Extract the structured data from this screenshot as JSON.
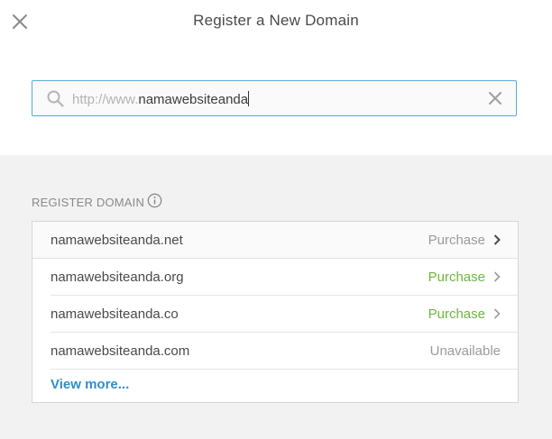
{
  "header": {
    "title": "Register a New Domain"
  },
  "search": {
    "prefix": "http://www.",
    "value": "namawebsiteanda"
  },
  "section": {
    "label": "REGISTER DOMAIN"
  },
  "domains": [
    {
      "name": "namawebsiteanda.net",
      "action": "Purchase",
      "status": "available-hover"
    },
    {
      "name": "namawebsiteanda.org",
      "action": "Purchase",
      "status": "available"
    },
    {
      "name": "namawebsiteanda.co",
      "action": "Purchase",
      "status": "available"
    },
    {
      "name": "namawebsiteanda.com",
      "action": "Unavailable",
      "status": "unavailable"
    }
  ],
  "view_more": "View more...",
  "colors": {
    "accent_blue": "#2f8fce",
    "purchase_green": "#6fb63d",
    "muted_grey": "#9b9b9b",
    "input_border": "#5aa9d6"
  },
  "icons": {
    "close": "close-icon",
    "search": "search-icon",
    "clear": "clear-icon",
    "info": "info-icon",
    "chevron": "chevron-right-icon"
  }
}
